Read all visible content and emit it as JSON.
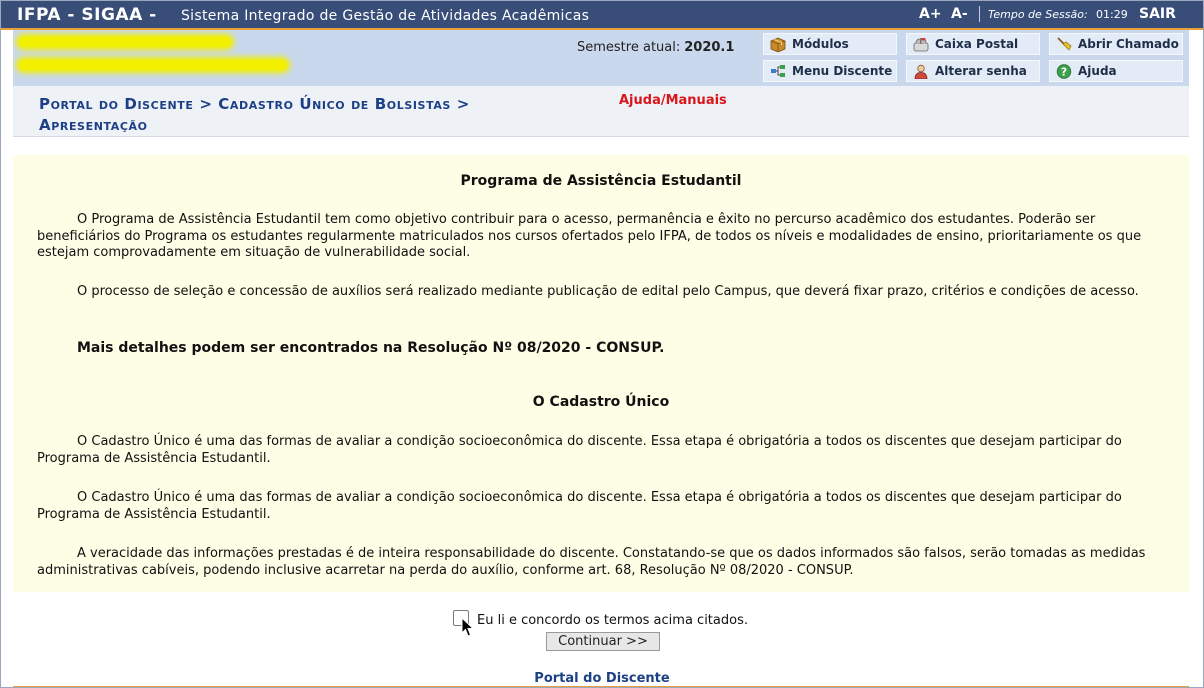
{
  "header": {
    "brand": "IFPA - SIGAA -",
    "fullname": "Sistema Integrado de Gestão de Atividades Acadêmicas",
    "font_increase": "A+",
    "font_decrease": "A-",
    "session_label": "Tempo de Sessão:",
    "session_time": "01:29",
    "logout": "SAIR"
  },
  "info": {
    "semester_label": "Semestre atual:",
    "semester_value": "2020.1"
  },
  "menu": {
    "modulos": "Módulos",
    "caixa_postal": "Caixa Postal",
    "abrir_chamado": "Abrir Chamado",
    "menu_discente": "Menu Discente",
    "alterar_senha": "Alterar senha",
    "ajuda": "Ajuda"
  },
  "breadcrumb": {
    "text": "Portal do Discente > Cadastro Único de Bolsistas > Apresentação",
    "help": "Ajuda/Manuais"
  },
  "content": {
    "title1": "Programa de Assistência Estudantil",
    "p1": "O Programa de Assistência Estudantil tem como objetivo contribuir para o acesso, permanência e êxito no percurso acadêmico dos estudantes. Poderão ser beneficiários do Programa os estudantes regularmente matriculados nos cursos ofertados pelo IFPA, de todos os níveis e modalidades de ensino, prioritariamente os que estejam comprovadamente em situação de vulnerabilidade social.",
    "p2": "O processo de seleção e concessão de auxílios será realizado mediante publicação de edital pelo Campus, que deverá fixar prazo, critérios e condições de acesso.",
    "p3": "Mais detalhes podem ser encontrados na Resolução Nº 08/2020 - CONSUP.",
    "title2": "O Cadastro Único",
    "p4": "O Cadastro Único é uma das formas de avaliar a condição socioeconômica do discente. Essa etapa é obrigatória a todos os discentes que desejam participar do Programa de Assistência Estudantil.",
    "p5": "O Cadastro Único é uma das formas de avaliar a condição socioeconômica do discente. Essa etapa é obrigatória a todos os discentes que desejam participar do Programa de Assistência Estudantil.",
    "p6": "A veracidade das informações prestadas é de inteira responsabilidade do discente. Constatando-se que os dados informados são falsos, serão tomadas as medidas administrativas cabíveis, podendo inclusive acarretar na perda do auxílio, conforme art. 68, Resolução Nº 08/2020 - CONSUP."
  },
  "form": {
    "agree_label": "Eu li e concordo os termos acima citados.",
    "agree_checked": false,
    "continue_label": "Continuar >>"
  },
  "footer": {
    "portal_link": "Portal do Discente"
  },
  "colors": {
    "topbar": "#384e78",
    "accent_orange": "#e8a038",
    "panel": "#c9d8ec",
    "content_bg": "#fefde5",
    "link": "#1d3f86",
    "help": "#d9161b"
  }
}
